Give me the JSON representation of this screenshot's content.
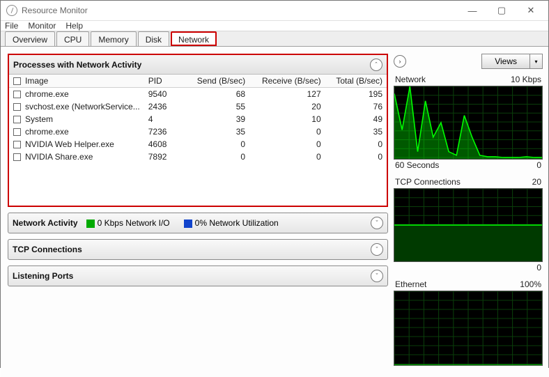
{
  "window": {
    "title": "Resource Monitor"
  },
  "menus": {
    "file": "File",
    "monitor": "Monitor",
    "help": "Help"
  },
  "tabs": {
    "overview": "Overview",
    "cpu": "CPU",
    "memory": "Memory",
    "disk": "Disk",
    "network": "Network"
  },
  "procs": {
    "title": "Processes with Network Activity",
    "cols": {
      "image": "Image",
      "pid": "PID",
      "send": "Send (B/sec)",
      "recv": "Receive (B/sec)",
      "total": "Total (B/sec)"
    },
    "rows": [
      {
        "image": "chrome.exe",
        "pid": "9540",
        "send": "68",
        "recv": "127",
        "total": "195"
      },
      {
        "image": "svchost.exe (NetworkService...",
        "pid": "2436",
        "send": "55",
        "recv": "20",
        "total": "76"
      },
      {
        "image": "System",
        "pid": "4",
        "send": "39",
        "recv": "10",
        "total": "49"
      },
      {
        "image": "chrome.exe",
        "pid": "7236",
        "send": "35",
        "recv": "0",
        "total": "35"
      },
      {
        "image": "NVIDIA Web Helper.exe",
        "pid": "4608",
        "send": "0",
        "recv": "0",
        "total": "0"
      },
      {
        "image": "NVIDIA Share.exe",
        "pid": "7892",
        "send": "0",
        "recv": "0",
        "total": "0"
      }
    ]
  },
  "net_activity": {
    "title": "Network Activity",
    "io": "0 Kbps Network I/O",
    "util": "0% Network Utilization"
  },
  "tcp": {
    "title": "TCP Connections"
  },
  "listen": {
    "title": "Listening Ports"
  },
  "side": {
    "views": "Views",
    "g1": {
      "title": "Network",
      "max": "10 Kbps",
      "footL": "60 Seconds",
      "footR": "0"
    },
    "g2": {
      "title": "TCP Connections",
      "max": "20",
      "footR": "0"
    },
    "g3": {
      "title": "Ethernet",
      "max": "100%"
    }
  },
  "chart_data": [
    {
      "type": "line",
      "title": "Network",
      "xlabel": "60 Seconds",
      "ylabel": "Kbps",
      "ylim": [
        0,
        10
      ],
      "xlim_seconds": [
        -60,
        0
      ],
      "series": [
        {
          "name": "network-io",
          "values": [
            9,
            4,
            10,
            1,
            8,
            3,
            5,
            1,
            0.5,
            6,
            3,
            0.5,
            0.3,
            0.3,
            0.2,
            0.2,
            0.2,
            0.3,
            0.2,
            0.2
          ]
        }
      ]
    },
    {
      "type": "area",
      "title": "TCP Connections",
      "ylim": [
        0,
        20
      ],
      "xlim_seconds": [
        -60,
        0
      ],
      "series": [
        {
          "name": "tcp-connections",
          "values": [
            10,
            10,
            10,
            10,
            10,
            10,
            10,
            10,
            10,
            10,
            10,
            10,
            10,
            10,
            10,
            10,
            10,
            10,
            10,
            10
          ]
        }
      ]
    },
    {
      "type": "area",
      "title": "Ethernet",
      "ylabel": "%",
      "ylim": [
        0,
        100
      ],
      "xlim_seconds": [
        -60,
        0
      ],
      "series": [
        {
          "name": "ethernet-util",
          "values": [
            0,
            0,
            0,
            0,
            0,
            0,
            0,
            0,
            0,
            0,
            0,
            0,
            0,
            0,
            0,
            0,
            0,
            0,
            0,
            0
          ]
        }
      ]
    }
  ]
}
